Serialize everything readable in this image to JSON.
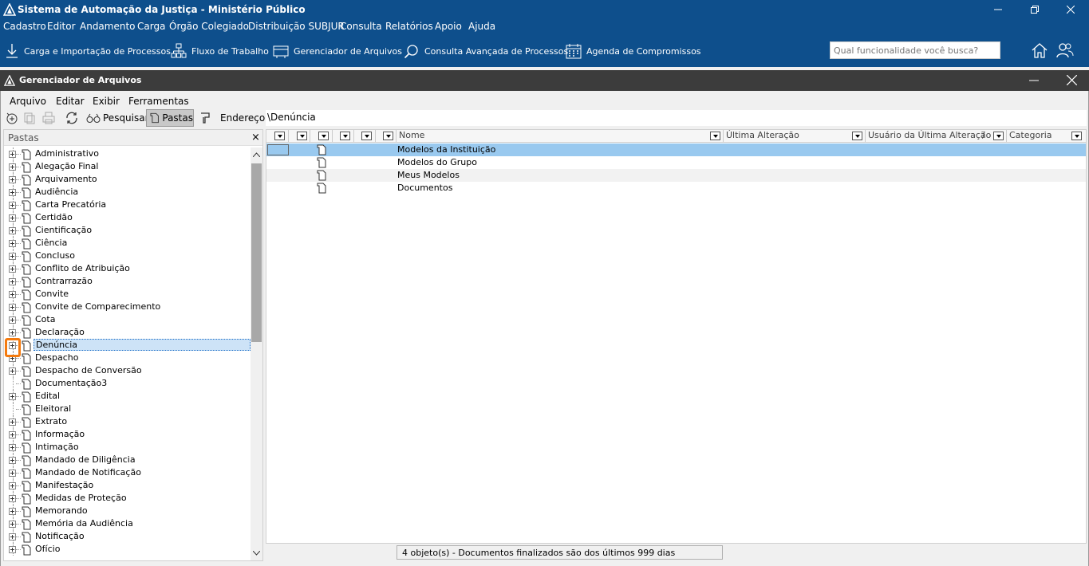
{
  "app": {
    "title": "Sistema de Automação da Justiça - Ministério Público"
  },
  "menu": [
    "Cadastro",
    "Editor",
    "Andamento",
    "Carga",
    "Órgão Colegiado",
    "Distribuição SUBJUR",
    "Consulta",
    "Relatórios",
    "Apoio",
    "Ajuda"
  ],
  "toolbar": {
    "carga": "Carga e Importação de Processos",
    "fluxo": "Fluxo de Trabalho",
    "gerenciador": "Gerenciador de Arquivos",
    "consulta": "Consulta Avançada de Processos",
    "agenda": "Agenda de Compromissos",
    "search_placeholder": "Qual funcionalidade você busca?"
  },
  "window": {
    "title": "Gerenciador de Arquivos"
  },
  "app_menu": [
    "Arquivo",
    "Editar",
    "Exibir",
    "Ferramentas"
  ],
  "tools": {
    "pesquisar": "Pesquisar",
    "pastas": "Pastas",
    "endereco": "Endereço",
    "address": "\\Denúncia"
  },
  "folders_pane": {
    "title": "Pastas",
    "close": "×"
  },
  "tree": [
    {
      "label": "Administrativo",
      "exp": true
    },
    {
      "label": "Alegação Final",
      "exp": true
    },
    {
      "label": "Arquivamento",
      "exp": true
    },
    {
      "label": "Audiência",
      "exp": true
    },
    {
      "label": "Carta Precatória",
      "exp": true
    },
    {
      "label": "Certidão",
      "exp": true
    },
    {
      "label": "Cientificação",
      "exp": true
    },
    {
      "label": "Ciência",
      "exp": true
    },
    {
      "label": "Concluso",
      "exp": true
    },
    {
      "label": "Conflito de Atribuição",
      "exp": true
    },
    {
      "label": "Contrarrazão",
      "exp": true
    },
    {
      "label": "Convite",
      "exp": true
    },
    {
      "label": "Convite de Comparecimento",
      "exp": true
    },
    {
      "label": "Cota",
      "exp": true
    },
    {
      "label": "Declaração",
      "exp": true
    },
    {
      "label": "Denúncia",
      "exp": true,
      "selected": true
    },
    {
      "label": "Despacho",
      "exp": true
    },
    {
      "label": "Despacho de Conversão",
      "exp": true
    },
    {
      "label": "Documentação3",
      "exp": false
    },
    {
      "label": "Edital",
      "exp": true
    },
    {
      "label": "Eleitoral",
      "exp": false
    },
    {
      "label": "Extrato",
      "exp": true
    },
    {
      "label": "Informação",
      "exp": true
    },
    {
      "label": "Intimação",
      "exp": true
    },
    {
      "label": "Mandado de Diligência",
      "exp": true
    },
    {
      "label": "Mandado de Notificação",
      "exp": true
    },
    {
      "label": "Manifestação",
      "exp": true
    },
    {
      "label": "Medidas de Proteção",
      "exp": true
    },
    {
      "label": "Memorando",
      "exp": true
    },
    {
      "label": "Memória da Audiência",
      "exp": true
    },
    {
      "label": "Notificação",
      "exp": true
    },
    {
      "label": "Ofício",
      "exp": true
    }
  ],
  "grid": {
    "headers": {
      "nome": "Nome",
      "ultima": "Última Alteração",
      "usuario": "Usuário da Última Alteração",
      "sort": "/",
      "categoria": "Categoria"
    },
    "rows": [
      "Modelos da Instituição",
      "Modelos do Grupo",
      "Meus Modelos",
      "Documentos"
    ]
  },
  "status": "4 objeto(s) - Documentos finalizados são dos últimos 999 dias",
  "colors": {
    "titlebar": "#0e4f8c",
    "subtitle": "#3c3c3c",
    "selection": "#99c9ef",
    "highlight": "#f47a0e"
  }
}
